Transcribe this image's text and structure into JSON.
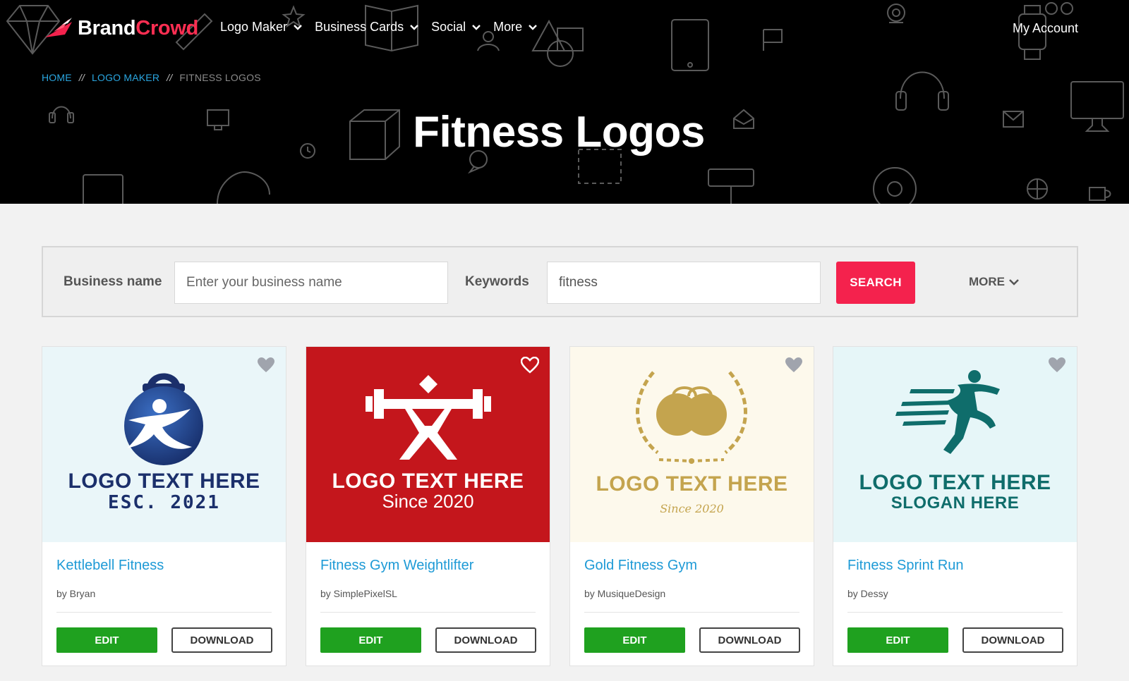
{
  "brand": {
    "part1": "Brand",
    "part2": "Crowd"
  },
  "nav": {
    "items": [
      {
        "label": "Logo Maker"
      },
      {
        "label": "Business Cards"
      },
      {
        "label": "Social"
      },
      {
        "label": "More"
      }
    ],
    "account": "My Account"
  },
  "breadcrumb": {
    "home": "HOME",
    "logo_maker": "LOGO MAKER",
    "current": "FITNESS LOGOS",
    "separator": "//"
  },
  "page_title": "Fitness Logos",
  "search": {
    "business_label": "Business name",
    "business_placeholder": "Enter your business name",
    "keywords_label": "Keywords",
    "keywords_value": "fitness",
    "search_button": "SEARCH",
    "more_label": "MORE"
  },
  "cards": [
    {
      "title": "Kettlebell Fitness",
      "author": "by Bryan",
      "logo_line1": "LOGO TEXT HERE",
      "logo_line2": "ESC. 2021",
      "bg": "#eaf6f9",
      "accent": "#1b2f6b",
      "edit": "EDIT",
      "download": "DOWNLOAD",
      "favorited": false
    },
    {
      "title": "Fitness Gym Weightlifter",
      "author": "by SimplePixelSL",
      "logo_line1": "LOGO TEXT HERE",
      "logo_line2": "Since 2020",
      "bg": "#c4161c",
      "accent": "#ffffff",
      "edit": "EDIT",
      "download": "DOWNLOAD",
      "favorited": false
    },
    {
      "title": "Gold Fitness Gym",
      "author": "by MusiqueDesign",
      "logo_line1": "LOGO TEXT HERE",
      "logo_line2": "Since 2020",
      "bg": "#fdf9ec",
      "accent": "#c4a44e",
      "edit": "EDIT",
      "download": "DOWNLOAD",
      "favorited": false
    },
    {
      "title": "Fitness Sprint Run",
      "author": "by Dessy",
      "logo_line1": "LOGO TEXT HERE",
      "logo_line2": "SLOGAN HERE",
      "bg": "#e6f6f8",
      "accent": "#0f6d6b",
      "edit": "EDIT",
      "download": "DOWNLOAD",
      "favorited": false
    }
  ],
  "colors": {
    "brand_red": "#f4224d",
    "link_blue": "#1e9ad6",
    "edit_green": "#1fa11f",
    "hero_bg": "#000000"
  }
}
